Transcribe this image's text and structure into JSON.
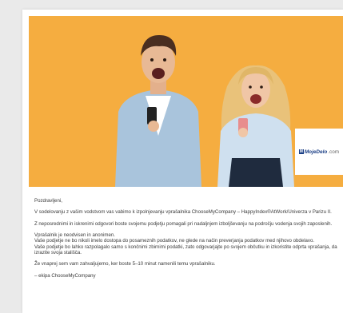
{
  "email": {
    "logo": {
      "mark": "M",
      "name": "MojeDelo",
      "tld": ".com"
    },
    "greeting": "Pozdravljeni,",
    "paragraphs": {
      "intro": "V sodelovanju z vašim vodstvom vas vabimo k izpolnjevanju vprašalnika ChooseMyCompany – HappyIndex®AtWork/Univerza v Parizu II.",
      "help": "Z neposrednimi in iskrenimi odgovori boste svojemu podjetju pomagali pri nadaljnjem izboljševanju na področju vodenja svojih zaposlenih.",
      "anon1": "Vprašalnik je neodvisen in anonimen.",
      "anon2": "Vaše podjetje ne bo nikoli imelo dostopa do posameznih podatkov, ne glede na način preverjanja podatkov med njihovo obdelavo.",
      "anon3": "Vaše podjetje bo lahko razpolagalo samo s končnimi zbirnimi podatki, zato odgovarjajte po svojem občutku in izkoristite odprta vprašanja, da izrazite svoja stališča.",
      "thanks": "Že vnaprej sem vam zahvaljujemo, ker boste 5–10 minut namenili temu vprašalniku.",
      "signature": "– ekipa ChooseMyCompany"
    }
  },
  "colors": {
    "hero_bg": "#f4a93b",
    "brand": "#1b3f86"
  }
}
